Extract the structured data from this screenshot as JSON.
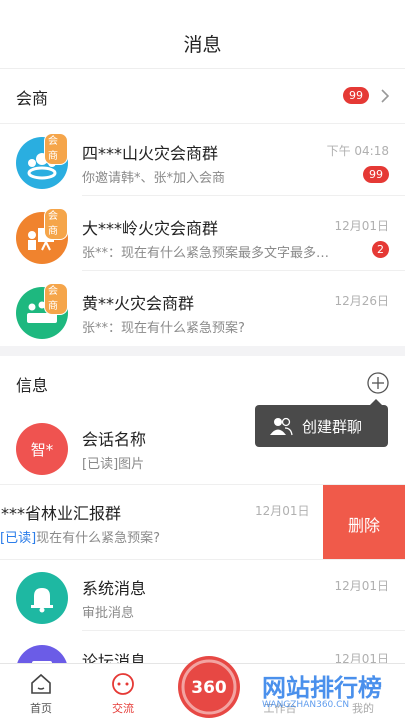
{
  "header": {
    "title": "消息"
  },
  "business_section": {
    "title": "会商",
    "badge": "99"
  },
  "business_groups": [
    {
      "tag": "会商",
      "name": "四***山火灾会商群",
      "preview": "你邀请韩*、张*加入会商",
      "time": "下午 04:18",
      "badge": "99",
      "color": "#2aaee0",
      "icon": "people-icon"
    },
    {
      "tag": "会商",
      "name": "大***岭火灾会商群",
      "preview": "张**：现在有什么紧急预案最多文字最多…",
      "time": "12月01日",
      "badge": "2",
      "color": "#f0832e",
      "icon": "presentation-icon"
    },
    {
      "tag": "会商",
      "name": "黄**火灾会商群",
      "preview": "张**：现在有什么紧急预案?",
      "time": "12月26日",
      "badge": "",
      "color": "#1eb87f",
      "icon": "meeting-icon"
    }
  ],
  "info_section": {
    "title": "信息"
  },
  "popover": {
    "label": "创建群聊"
  },
  "conversations": [
    {
      "avatar_text": "智*",
      "name": "会话名称",
      "preview": "[已读]图片",
      "time": "",
      "color": "#ef5350"
    },
    {
      "name": "***省林业汇报群",
      "read_tag": "[已读]",
      "preview": "现在有什么紧急预案?",
      "time": "12月01日",
      "delete_label": "删除"
    },
    {
      "name": "系统消息",
      "preview": "审批消息",
      "time": "12月01日",
      "color": "#1eb8a2",
      "icon": "bell-icon"
    },
    {
      "name": "论坛消息",
      "preview": "",
      "time": "12月01日",
      "color": "#6b5ce7",
      "icon": "forum-icon"
    }
  ],
  "tabbar": {
    "items": [
      {
        "label": "首页",
        "icon": "home-icon"
      },
      {
        "label": "交流",
        "icon": "chat-icon"
      },
      {
        "label": "工作台",
        "icon": "work-icon"
      },
      {
        "label": "我的",
        "icon": "me-icon"
      }
    ]
  },
  "watermark": {
    "title": "网站排行榜",
    "url": "WANGZHAN360.CN"
  }
}
